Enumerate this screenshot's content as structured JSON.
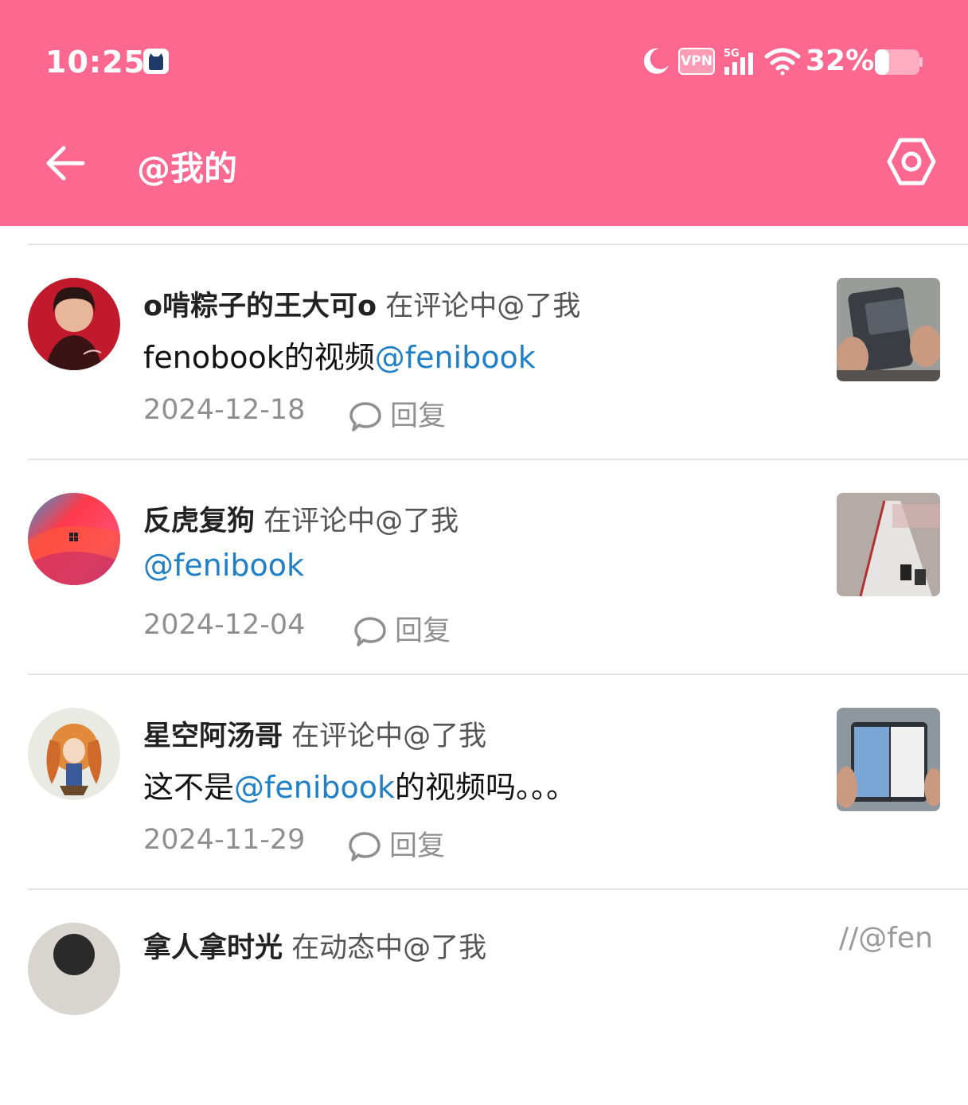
{
  "status_bar": {
    "time": "10:25",
    "vpn_label": "VPN",
    "network_label": "5G",
    "battery_text": "32%",
    "battery_level": 0.32
  },
  "app_bar": {
    "title": "@我的"
  },
  "colors": {
    "header_bg": "#fd6890",
    "mention": "#1f7fc7",
    "meta_gray": "#8f8f8f"
  },
  "items": [
    {
      "name": "o啃粽子的王大可o",
      "action": "在评论中@了我",
      "content_before": "fenobook的视频",
      "mention": "@fenibook",
      "content_after": "",
      "date": "2024-12-18",
      "reply_label": "回复"
    },
    {
      "name": "反虎复狗",
      "action": "在评论中@了我",
      "content_before": "",
      "mention": "@fenibook",
      "content_after": "",
      "date": "2024-12-04",
      "reply_label": "回复"
    },
    {
      "name": "星空阿汤哥",
      "action": "在评论中@了我",
      "content_before": "这不是",
      "mention": "@fenibook",
      "content_after": "的视频吗。。。",
      "date": "2024-11-29",
      "reply_label": "回复"
    },
    {
      "name": "拿人拿时光",
      "action": "在动态中@了我",
      "preview": "//@fen"
    }
  ]
}
